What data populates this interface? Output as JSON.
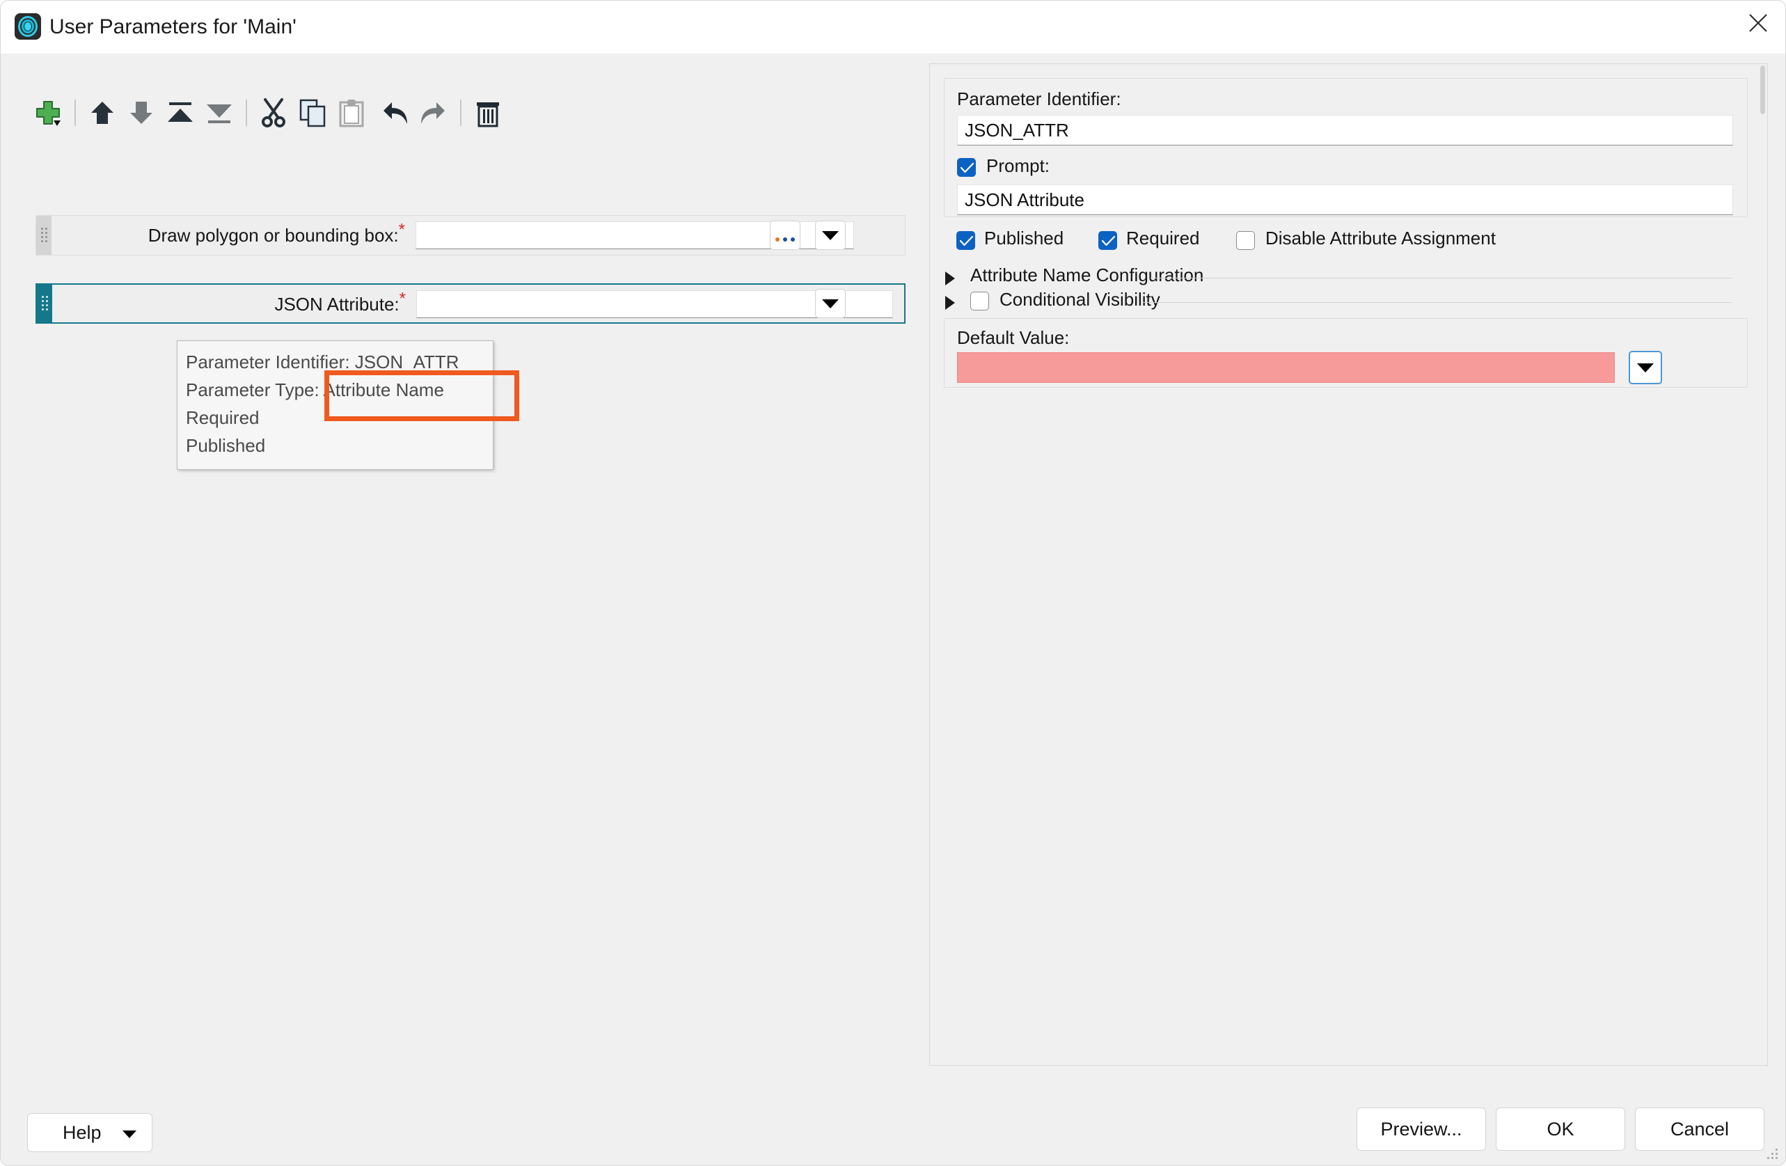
{
  "window": {
    "title": "User Parameters for 'Main'",
    "app_icon": "fme-logo-icon",
    "close_icon": "close-icon"
  },
  "toolbar": {
    "items": [
      {
        "name": "add-parameter-button",
        "icon": "plus-icon",
        "label": "Add"
      },
      {
        "name": "move-up-button",
        "icon": "arrow-up-icon",
        "label": "Move Up"
      },
      {
        "name": "move-down-button",
        "icon": "arrow-down-icon",
        "label": "Move Down"
      },
      {
        "name": "move-to-top-button",
        "icon": "move-to-top-icon",
        "label": "Move To Top"
      },
      {
        "name": "move-to-bottom-button",
        "icon": "move-to-bottom-icon",
        "label": "Move To Bottom"
      },
      {
        "name": "cut-button",
        "icon": "scissors-icon",
        "label": "Cut"
      },
      {
        "name": "copy-button",
        "icon": "copy-icon",
        "label": "Copy"
      },
      {
        "name": "paste-button",
        "icon": "clipboard-icon",
        "label": "Paste"
      },
      {
        "name": "undo-button",
        "icon": "undo-arrow-icon",
        "label": "Undo"
      },
      {
        "name": "redo-button",
        "icon": "redo-arrow-icon",
        "label": "Redo"
      },
      {
        "name": "delete-button",
        "icon": "trash-icon",
        "label": "Delete"
      }
    ]
  },
  "parameters": [
    {
      "label": "Draw polygon or bounding box:",
      "required_marker": "*",
      "value": "",
      "browse_label": "...",
      "selected": false
    },
    {
      "label": "JSON Attribute:",
      "required_marker": "*",
      "value": "",
      "selected": true
    }
  ],
  "tooltip": {
    "lines": [
      "Parameter Identifier: JSON_ATTR",
      "Parameter Type: Attribute Name",
      "Required",
      "Published"
    ],
    "highlight_color": "#ef5a1f",
    "highlighted_text": "Attribute Name"
  },
  "editor": {
    "identifier_label": "Parameter Identifier:",
    "identifier_value": "JSON_ATTR",
    "prompt_checkbox_label": "Prompt:",
    "prompt_checked": true,
    "prompt_value": "JSON Attribute",
    "flags": [
      {
        "label": "Published",
        "checked": true
      },
      {
        "label": "Required",
        "checked": true
      },
      {
        "label": "Disable Attribute Assignment",
        "checked": false
      }
    ],
    "sections": [
      {
        "label": "Attribute Name Configuration",
        "expanded": false,
        "has_checkbox": false
      },
      {
        "label": "Conditional Visibility",
        "expanded": false,
        "has_checkbox": true,
        "checked": false
      }
    ],
    "default_value_label": "Default Value:",
    "default_value": "",
    "default_value_error": true,
    "default_value_error_color": "#f79a9a"
  },
  "footer": {
    "help_label": "Help",
    "preview_label": "Preview...",
    "ok_label": "OK",
    "cancel_label": "Cancel"
  },
  "colors": {
    "accent_teal": "#15788a",
    "checkbox_blue": "#0c62c2",
    "required_red": "#d92626",
    "annotation_orange": "#ef5a1f",
    "error_pink": "#f79a9a"
  }
}
